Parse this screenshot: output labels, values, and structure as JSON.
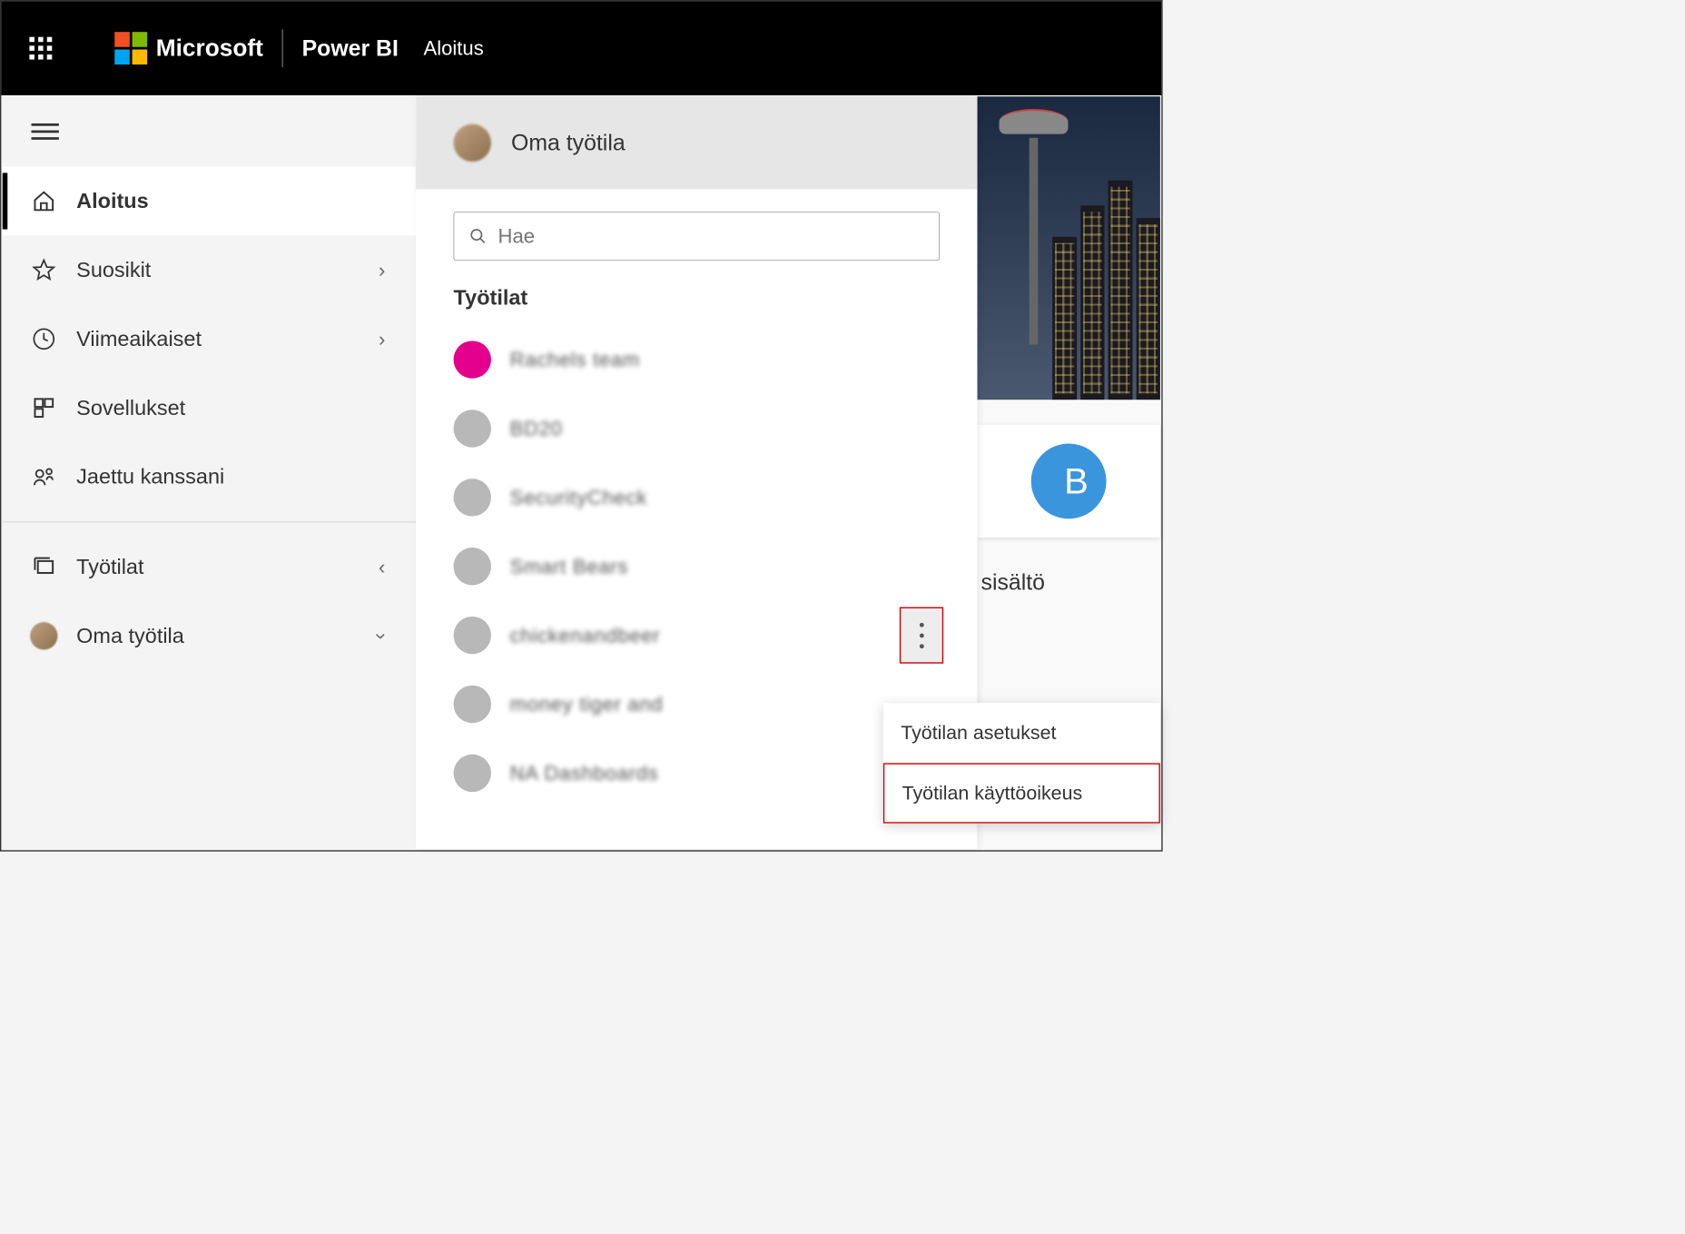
{
  "header": {
    "brand": "Microsoft",
    "product": "Power BI",
    "page": "Aloitus"
  },
  "nav": {
    "items": [
      {
        "icon": "home",
        "label": "Aloitus",
        "active": true,
        "chevron": ""
      },
      {
        "icon": "star",
        "label": "Suosikit",
        "active": false,
        "chevron": "›"
      },
      {
        "icon": "clock",
        "label": "Viimeaikaiset",
        "active": false,
        "chevron": "›"
      },
      {
        "icon": "apps",
        "label": "Sovellukset",
        "active": false,
        "chevron": ""
      },
      {
        "icon": "share",
        "label": "Jaettu kanssani",
        "active": false,
        "chevron": ""
      }
    ],
    "workspaces_label": "Työtilat",
    "my_workspace": "Oma työtila"
  },
  "flyout": {
    "header": "Oma työtila",
    "search_placeholder": "Hae",
    "section": "Työtilat",
    "items": [
      {
        "color": "pink",
        "label": "Rachels team"
      },
      {
        "color": "gray",
        "label": "BD20"
      },
      {
        "color": "gray",
        "label": "SecurityCheck"
      },
      {
        "color": "gray",
        "label": "Smart Bears"
      },
      {
        "color": "gray",
        "label": "chickenandbeer",
        "more": true
      },
      {
        "color": "gray",
        "label": "money tiger and"
      },
      {
        "color": "gray",
        "label": "NA Dashboards"
      }
    ]
  },
  "bg": {
    "avatar_letter": "B",
    "tile_label": "sisältö"
  },
  "menu": {
    "item1": "Työtilan asetukset",
    "item2": "Työtilan käyttöoikeus"
  }
}
